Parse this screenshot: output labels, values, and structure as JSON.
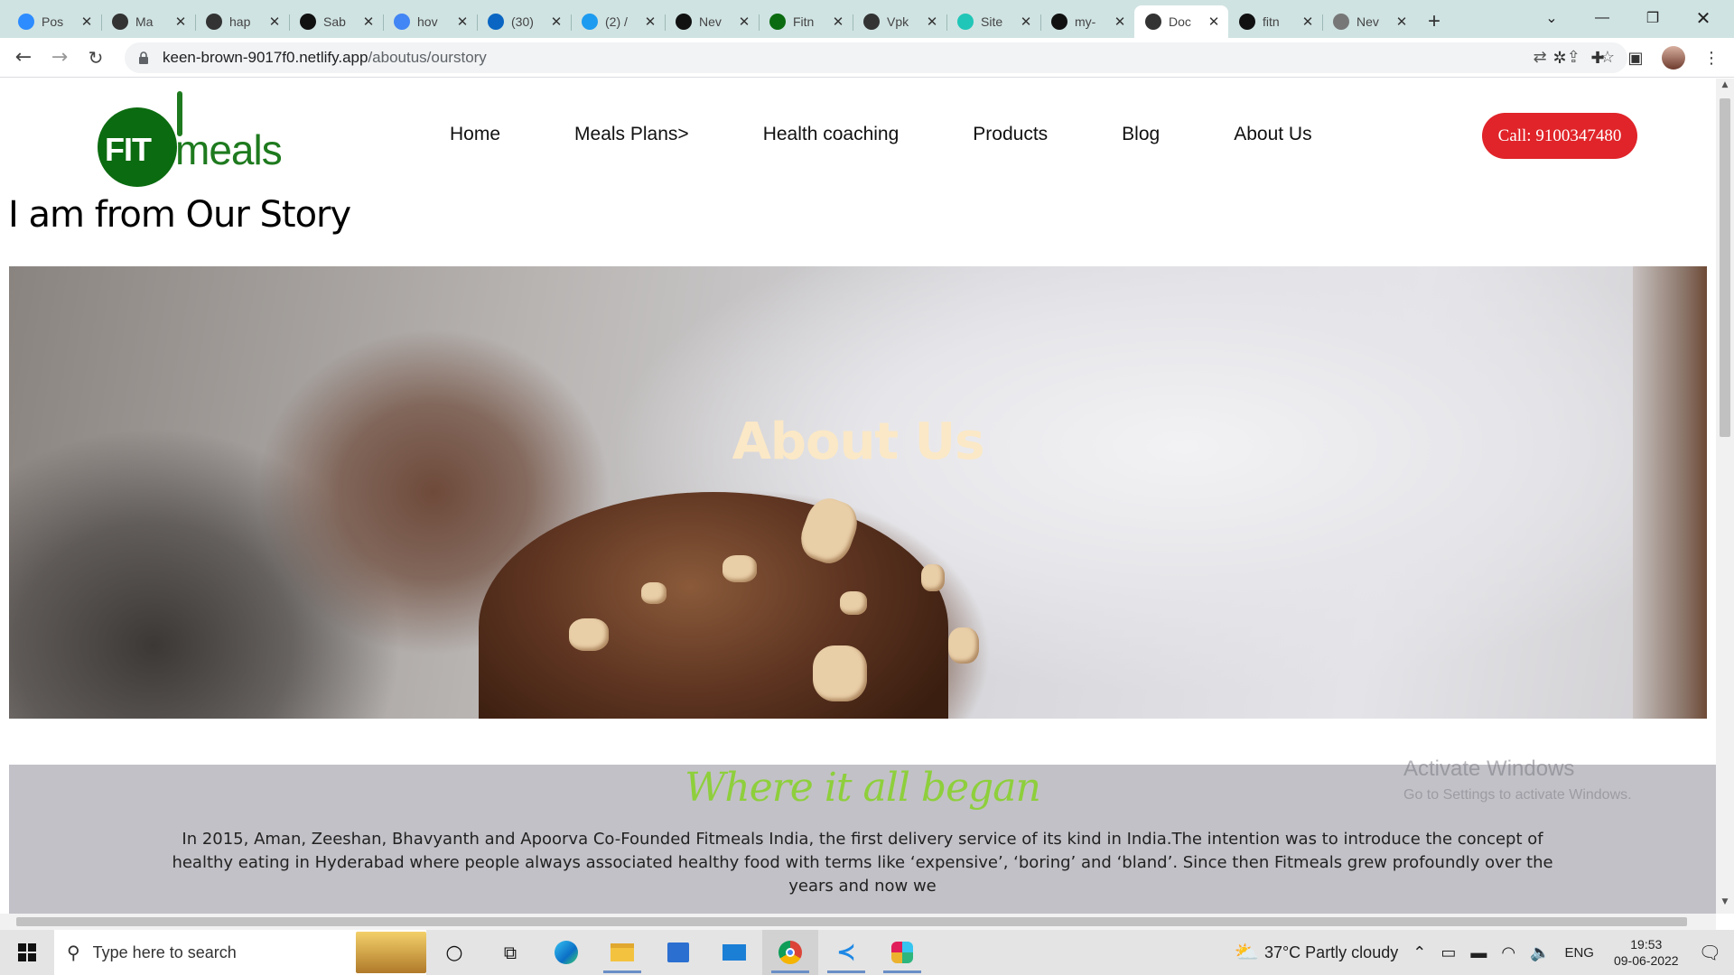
{
  "browser": {
    "tabs": [
      {
        "label": "Pos",
        "favicon": "zoom-icon",
        "color": "#2d8cff"
      },
      {
        "label": "Ma",
        "favicon": "globe-icon",
        "color": "#333333"
      },
      {
        "label": "hap",
        "favicon": "square-icon",
        "color": "#333333"
      },
      {
        "label": "Sab",
        "favicon": "github-icon",
        "color": "#111111"
      },
      {
        "label": "hov",
        "favicon": "google-icon",
        "color": "#4285f4"
      },
      {
        "label": "(30)",
        "favicon": "linkedin-icon",
        "color": "#0a66c2"
      },
      {
        "label": "(2) /",
        "favicon": "twitter-icon",
        "color": "#1d9bf0"
      },
      {
        "label": "Nev",
        "favicon": "github-icon",
        "color": "#111111"
      },
      {
        "label": "Fitn",
        "favicon": "fitmeals-icon",
        "color": "#0b6b10"
      },
      {
        "label": "Vpk",
        "favicon": "globe-icon",
        "color": "#333333"
      },
      {
        "label": "Site",
        "favicon": "netlify-icon",
        "color": "#20c6b7"
      },
      {
        "label": "my-",
        "favicon": "vercel-icon",
        "color": "#111111"
      },
      {
        "label": "Doc",
        "favicon": "globe-icon",
        "color": "#333333",
        "active": true
      },
      {
        "label": "fitn",
        "favicon": "github-icon",
        "color": "#111111"
      },
      {
        "label": "Nev",
        "favicon": "chrome-icon",
        "color": "#777777"
      }
    ],
    "new_tab_label": "+",
    "url_host": "keen-brown-9017f0.netlify.app",
    "url_path": "/aboutus/ourstory"
  },
  "site": {
    "logo": {
      "fit": "FIT",
      "meals": "meals"
    },
    "nav": [
      "Home",
      "Meals Plans>",
      "Health coaching",
      "Products",
      "Blog",
      "About Us"
    ],
    "call_button": "Call: 9100347480",
    "page_heading": "I am from Our Story",
    "hero_title": "About Us",
    "story_title": "Where it all began",
    "story_text": "In 2015, Aman, Zeeshan, Bhavyanth and Apoorva Co-Founded Fitmeals India, the first delivery service of its kind in India.The intention was to introduce the concept of healthy eating in Hyderabad where people always associated healthy food with terms like ‘expensive’, ‘boring’ and ‘bland’. Since then Fitmeals grew profoundly over the years and now we",
    "watermark_title": "Activate Windows",
    "watermark_sub": "Go to Settings to activate Windows."
  },
  "taskbar": {
    "search_placeholder": "Type here to search",
    "weather": "37°C  Partly cloudy",
    "language": "ENG",
    "time": "19:53",
    "date": "09-06-2022"
  }
}
